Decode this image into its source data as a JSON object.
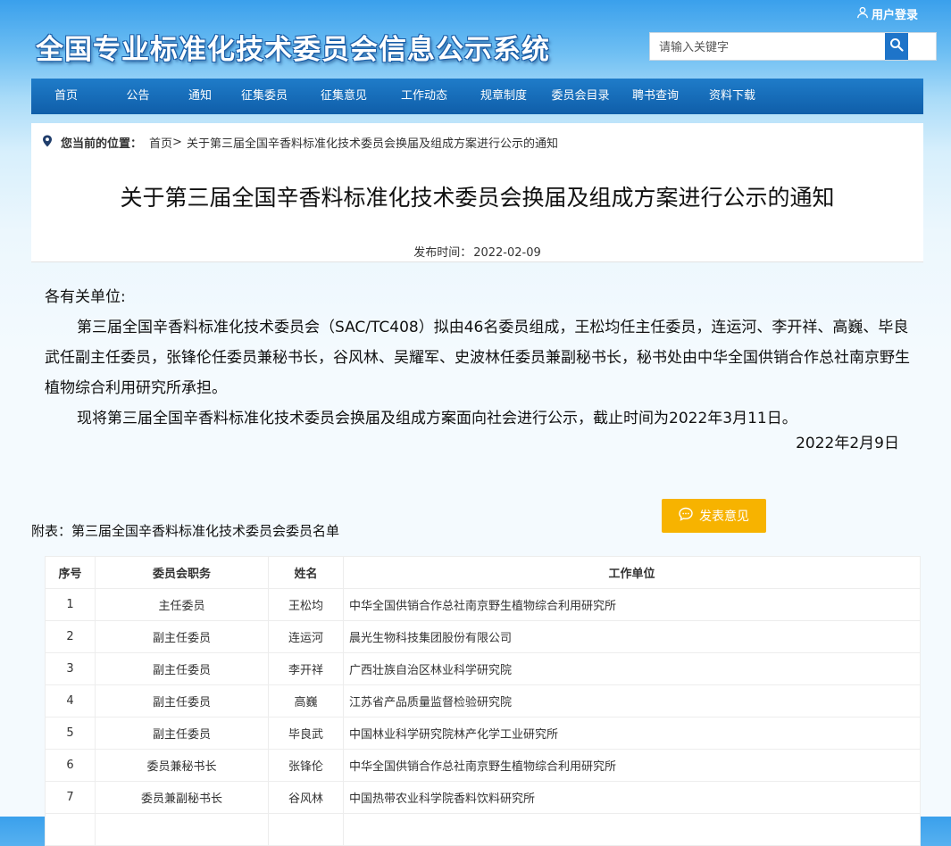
{
  "header": {
    "login_label": "用户登录",
    "site_title": "全国专业标准化技术委员会信息公示系统",
    "search_placeholder": "请输入关键字"
  },
  "nav": {
    "items": [
      {
        "label": "首页"
      },
      {
        "label": "公告"
      },
      {
        "label": "通知"
      },
      {
        "label": "征集委员"
      },
      {
        "label": "征集意见"
      },
      {
        "label": "工作动态"
      },
      {
        "label": "规章制度"
      },
      {
        "label": "委员会目录"
      },
      {
        "label": "聘书查询"
      },
      {
        "label": "资料下载"
      }
    ]
  },
  "breadcrumb": {
    "lead": "您当前的位置：",
    "home": "首页",
    "separator": ">",
    "current": "关于第三届全国辛香料标准化技术委员会换届及组成方案进行公示的通知"
  },
  "article": {
    "title": "关于第三届全国辛香料标准化技术委员会换届及组成方案进行公示的通知",
    "publish_label": "发布时间：",
    "publish_date": "2022-02-09",
    "salutation": "各有关单位:",
    "paragraph1": "第三届全国辛香料标准化技术委员会（SAC/TC408）拟由46名委员组成，王松均任主任委员，连运河、李开祥、高巍、毕良武任副主任委员，张锋伦任委员兼秘书长，谷风林、吴耀军、史波林任委员兼副秘书长，秘书处由中华全国供销合作总社南京野生植物综合利用研究所承担。",
    "paragraph2": "现将第三届全国辛香料标准化技术委员会换届及组成方案面向社会进行公示，截止时间为2022年3月11日。",
    "signature_date": "2022年2月9日"
  },
  "feedback_button": "发表意见",
  "attachment_title": "附表：第三届全国辛香料标准化技术委员会委员名单",
  "table": {
    "headers": [
      "序号",
      "委员会职务",
      "姓名",
      "工作单位"
    ],
    "rows": [
      [
        "1",
        "主任委员",
        "王松均",
        "中华全国供销合作总社南京野生植物综合利用研究所"
      ],
      [
        "2",
        "副主任委员",
        "连运河",
        "晨光生物科技集团股份有限公司"
      ],
      [
        "3",
        "副主任委员",
        "李开祥",
        "广西壮族自治区林业科学研究院"
      ],
      [
        "4",
        "副主任委员",
        "高巍",
        "江苏省产品质量监督检验研究院"
      ],
      [
        "5",
        "副主任委员",
        "毕良武",
        "中国林业科学研究院林产化学工业研究所"
      ],
      [
        "6",
        "委员兼秘书长",
        "张锋伦",
        "中华全国供销合作总社南京野生植物综合利用研究所"
      ],
      [
        "7",
        "委员兼副秘书长",
        "谷风林",
        "中国热带农业科学院香料饮料研究所"
      ],
      [
        "",
        "",
        "",
        ""
      ]
    ]
  },
  "colors": {
    "nav_bg": "#1568b8",
    "feedback_button": "#f7b300",
    "search_button": "#1e74c9"
  }
}
